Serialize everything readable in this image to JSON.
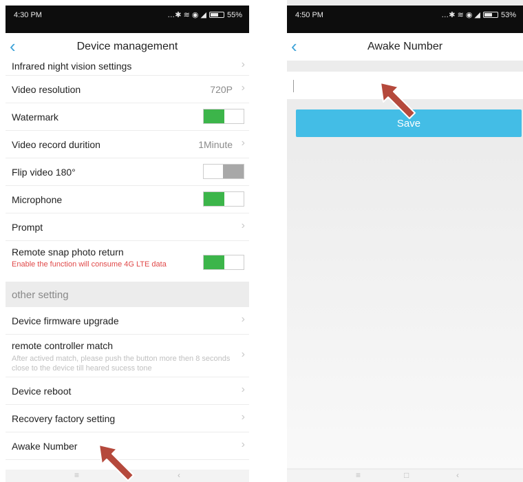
{
  "left": {
    "status": {
      "time": "4:30 PM",
      "battery": "55%"
    },
    "nav": {
      "back": "‹",
      "title": "Device management"
    },
    "rows": [
      {
        "label": "Infrared night vision settings"
      },
      {
        "label": "Video resolution",
        "value": "720P"
      },
      {
        "label": "Watermark",
        "toggle": "on"
      },
      {
        "label": "Video record durition",
        "value": "1Minute"
      },
      {
        "label": "Flip video 180°",
        "toggle": "off"
      },
      {
        "label": "Microphone",
        "toggle": "on"
      },
      {
        "label": "Prompt"
      },
      {
        "label": "Remote snap photo return",
        "sub": "Enable the function will consume 4G LTE data",
        "toggle": "on"
      }
    ],
    "section": "other setting",
    "rows2": [
      {
        "label": "Device firmware upgrade"
      },
      {
        "label": "remote controller match",
        "sub": "After actived match, please push the button more then 8 seconds close to the device till heared sucess tone"
      },
      {
        "label": "Device reboot"
      },
      {
        "label": "Recovery factory setting"
      },
      {
        "label": "Awake Number"
      }
    ],
    "bottom": {
      "menu": "≡",
      "back": "‹"
    }
  },
  "right": {
    "status": {
      "time": "4:50 PM",
      "battery": "53%"
    },
    "nav": {
      "back": "‹",
      "title": "Awake Number"
    },
    "input": {
      "value": "",
      "placeholder": ""
    },
    "save_label": "Save",
    "bottom": {
      "menu": "≡",
      "home": "□",
      "back": "‹"
    }
  },
  "colors": {
    "accent": "#3fa3d8",
    "toggle_on": "#3cb54a",
    "save_bg": "#43bde6",
    "warning": "#e04848",
    "arrow": "#b5493c"
  },
  "icons": {
    "back": "chevron-left-icon",
    "chevron": "chevron-right-icon",
    "arrow": "pointer-arrow-icon"
  }
}
